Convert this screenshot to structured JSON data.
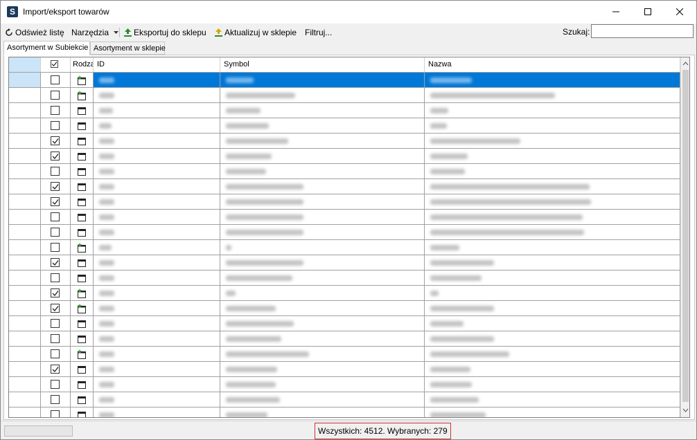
{
  "window": {
    "title": "Import/eksport towarów",
    "app_icon_letter": "S"
  },
  "toolbar": {
    "refresh_label": "Odśwież listę",
    "tools_label": "Narzędzia",
    "export_label": "Eksportuj do sklepu",
    "update_label": "Aktualizuj w sklepie",
    "filter_label": "Filtruj...",
    "search_label": "Szukaj:",
    "search_value": ""
  },
  "tabs": [
    {
      "label": "Asortyment w Subiekcie",
      "active": true
    },
    {
      "label": "Asortyment w sklepie",
      "active": false
    }
  ],
  "grid": {
    "columns": {
      "check": "☑",
      "kind": "Rodzaj",
      "id": "ID",
      "symbol": "Symbol",
      "name": "Nazwa"
    },
    "rows": [
      {
        "checked": false,
        "kind": "new",
        "selected": true
      },
      {
        "checked": false,
        "kind": "new",
        "selected": false
      },
      {
        "checked": false,
        "kind": "window",
        "selected": false
      },
      {
        "checked": false,
        "kind": "window",
        "selected": false
      },
      {
        "checked": true,
        "kind": "window",
        "selected": false
      },
      {
        "checked": true,
        "kind": "window",
        "selected": false
      },
      {
        "checked": false,
        "kind": "window",
        "selected": false
      },
      {
        "checked": true,
        "kind": "window",
        "selected": false
      },
      {
        "checked": true,
        "kind": "window",
        "selected": false
      },
      {
        "checked": false,
        "kind": "window",
        "selected": false
      },
      {
        "checked": false,
        "kind": "window",
        "selected": false
      },
      {
        "checked": false,
        "kind": "new",
        "selected": false
      },
      {
        "checked": true,
        "kind": "window",
        "selected": false
      },
      {
        "checked": false,
        "kind": "window",
        "selected": false
      },
      {
        "checked": true,
        "kind": "new",
        "selected": false
      },
      {
        "checked": true,
        "kind": "new",
        "selected": false
      },
      {
        "checked": false,
        "kind": "window",
        "selected": false
      },
      {
        "checked": false,
        "kind": "window",
        "selected": false
      },
      {
        "checked": false,
        "kind": "new",
        "selected": false
      },
      {
        "checked": true,
        "kind": "window",
        "selected": false
      },
      {
        "checked": false,
        "kind": "window",
        "selected": false
      },
      {
        "checked": false,
        "kind": "window",
        "selected": false
      },
      {
        "checked": false,
        "kind": "window",
        "selected": false
      }
    ]
  },
  "status": {
    "summary": "Wszystkich: 4512. Wybranych: 279"
  },
  "colors": {
    "selection": "#0078d7",
    "status_border": "#d03030",
    "export_icon": "#2a8a2a",
    "update_icon": "#d4a800"
  }
}
